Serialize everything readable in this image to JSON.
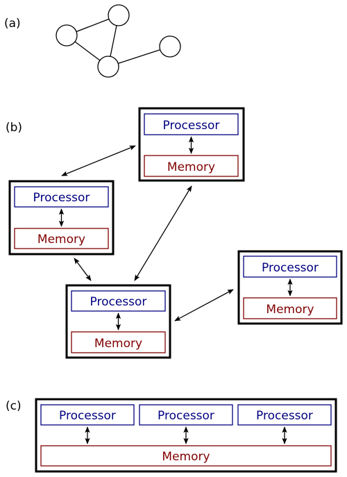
{
  "labels": {
    "a": "(a)",
    "b": "(b)",
    "c": "(c)"
  },
  "colors": {
    "processor": "#000080",
    "memory": "#800000",
    "outline": "#000000"
  },
  "part_a": {
    "description": "Graph of 4 nodes",
    "nodes": [
      "n1",
      "n2",
      "n3",
      "n4"
    ],
    "edges": [
      [
        "n1",
        "n2"
      ],
      [
        "n1",
        "n3"
      ],
      [
        "n2",
        "n3"
      ],
      [
        "n3",
        "n4"
      ]
    ]
  },
  "part_b": {
    "description": "Distributed memory: each node has its own processor and memory",
    "nodes": [
      {
        "id": "top",
        "processor": "Processor",
        "memory": "Memory"
      },
      {
        "id": "left",
        "processor": "Processor",
        "memory": "Memory"
      },
      {
        "id": "center",
        "processor": "Processor",
        "memory": "Memory"
      },
      {
        "id": "right",
        "processor": "Processor",
        "memory": "Memory"
      }
    ],
    "links": [
      [
        "left",
        "top"
      ],
      [
        "top",
        "center"
      ],
      [
        "left",
        "center"
      ],
      [
        "center",
        "right"
      ]
    ]
  },
  "part_c": {
    "description": "Shared memory: multiple processors share one memory",
    "processors": [
      "Processor",
      "Processor",
      "Processor"
    ],
    "memory": "Memory"
  }
}
